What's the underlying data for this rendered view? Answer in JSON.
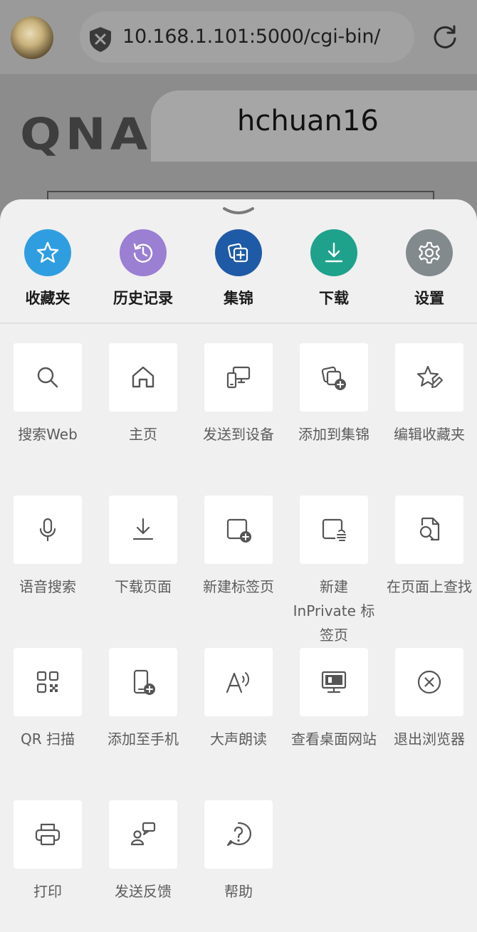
{
  "browser": {
    "url": "10.168.1.101:5000/cgi-bin/",
    "shield_icon": "shield-x-icon",
    "reload_icon": "reload-icon"
  },
  "page": {
    "logo_text": "QNA",
    "tooltip_text": "hchuan16"
  },
  "quick_actions": [
    {
      "label": "收藏夹",
      "icon": "star-icon",
      "color": "#2f9ee0"
    },
    {
      "label": "历史记录",
      "icon": "history-icon",
      "color": "#9a7fd3"
    },
    {
      "label": "集锦",
      "icon": "collections-icon",
      "color": "#1f5aa6"
    },
    {
      "label": "下载",
      "icon": "download-icon",
      "color": "#1ea28c"
    },
    {
      "label": "设置",
      "icon": "gear-icon",
      "color": "#838a8e"
    }
  ],
  "menu": [
    {
      "label": "搜索Web",
      "icon": "search-icon"
    },
    {
      "label": "主页",
      "icon": "home-icon"
    },
    {
      "label": "发送到设备",
      "icon": "send-to-device-icon"
    },
    {
      "label": "添加到集锦",
      "icon": "add-to-collections-icon"
    },
    {
      "label": "编辑收藏夹",
      "icon": "edit-favorites-icon"
    },
    {
      "label": "语音搜索",
      "icon": "microphone-icon"
    },
    {
      "label": "下载页面",
      "icon": "download-page-icon"
    },
    {
      "label": "新建标签页",
      "icon": "new-tab-icon"
    },
    {
      "label": "新建 InPrivate 标签页",
      "icon": "inprivate-tab-icon"
    },
    {
      "label": "在页面上查找",
      "icon": "find-on-page-icon"
    },
    {
      "label": "QR 扫描",
      "icon": "qr-code-icon"
    },
    {
      "label": "添加至手机",
      "icon": "add-to-phone-icon"
    },
    {
      "label": "大声朗读",
      "icon": "read-aloud-icon"
    },
    {
      "label": "查看桌面网站",
      "icon": "desktop-site-icon"
    },
    {
      "label": "退出浏览器",
      "icon": "exit-icon"
    },
    {
      "label": "打印",
      "icon": "print-icon"
    },
    {
      "label": "发送反馈",
      "icon": "feedback-icon"
    },
    {
      "label": "帮助",
      "icon": "help-icon"
    }
  ]
}
